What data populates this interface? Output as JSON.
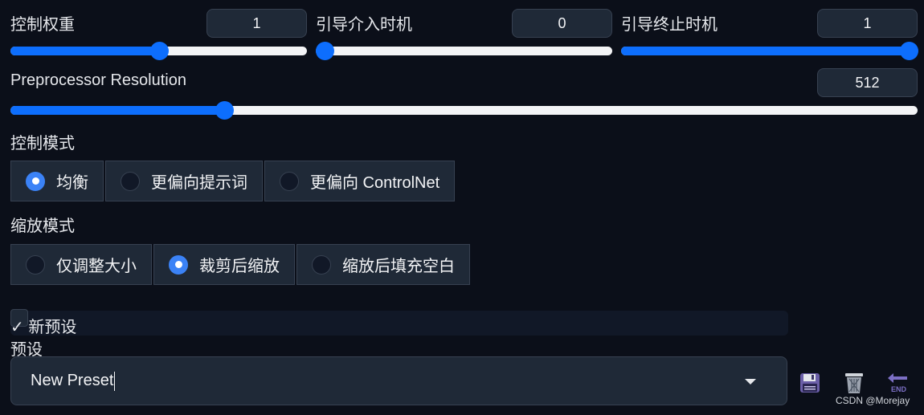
{
  "controls": {
    "control_weight": {
      "label": "控制权重",
      "value": "1",
      "level": 0.5
    },
    "guidance_start": {
      "label": "引导介入时机",
      "value": "0",
      "level": 0.0
    },
    "guidance_end": {
      "label": "引导终止时机",
      "value": "1",
      "level": 1.0
    },
    "preprocessor_resolution": {
      "label": "Preprocessor Resolution",
      "value": "512",
      "level": 0.23
    }
  },
  "control_mode": {
    "label": "控制模式",
    "options": [
      "均衡",
      "更偏向提示词",
      "更偏向 ControlNet"
    ],
    "selected": "均衡"
  },
  "resize_mode": {
    "label": "缩放模式",
    "options": [
      "仅调整大小",
      "裁剪后缩放",
      "缩放后填充空白"
    ],
    "selected": "裁剪后缩放"
  },
  "new_preset": {
    "label": "✓ 新预设"
  },
  "preset": {
    "label": "预设",
    "value": "New Preset"
  },
  "icons": [
    "floppy-disk-icon",
    "wastebasket-icon",
    "end-arrow-icon"
  ],
  "watermark": "CSDN @Morejay",
  "colors": {
    "accent": "#0d6efd",
    "background": "#0b0f19",
    "panel": "#1f2937"
  }
}
